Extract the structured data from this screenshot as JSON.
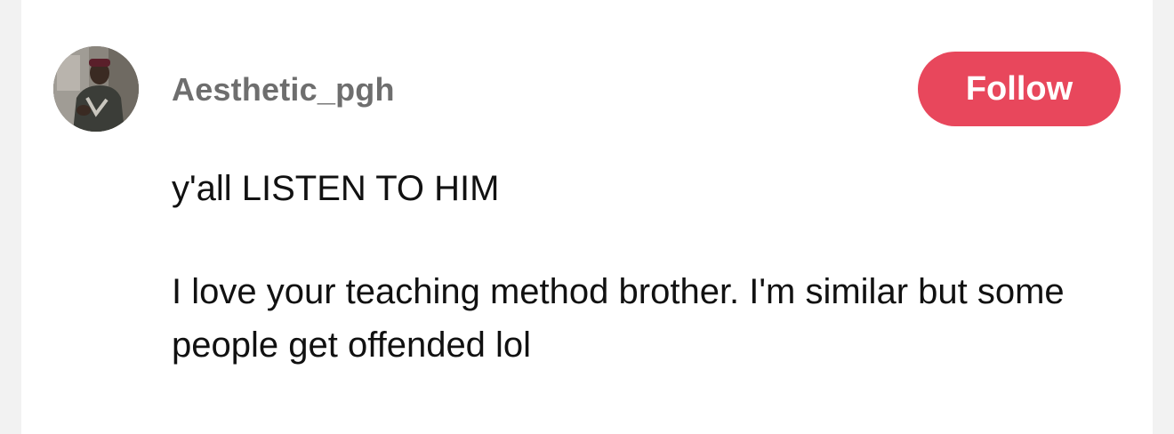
{
  "post": {
    "author": {
      "username": "Aesthetic_pgh",
      "avatar_icon": "user-avatar-photo"
    },
    "follow_label": "Follow",
    "title": "y'all LISTEN TO HIM",
    "body": "I love your teaching method brother. I'm similar but some people get offended lol"
  },
  "colors": {
    "accent": "#e8475c",
    "username": "#6e6e6e",
    "text": "#111111",
    "background": "#ffffff",
    "page_margin": "#f2f2f2"
  }
}
